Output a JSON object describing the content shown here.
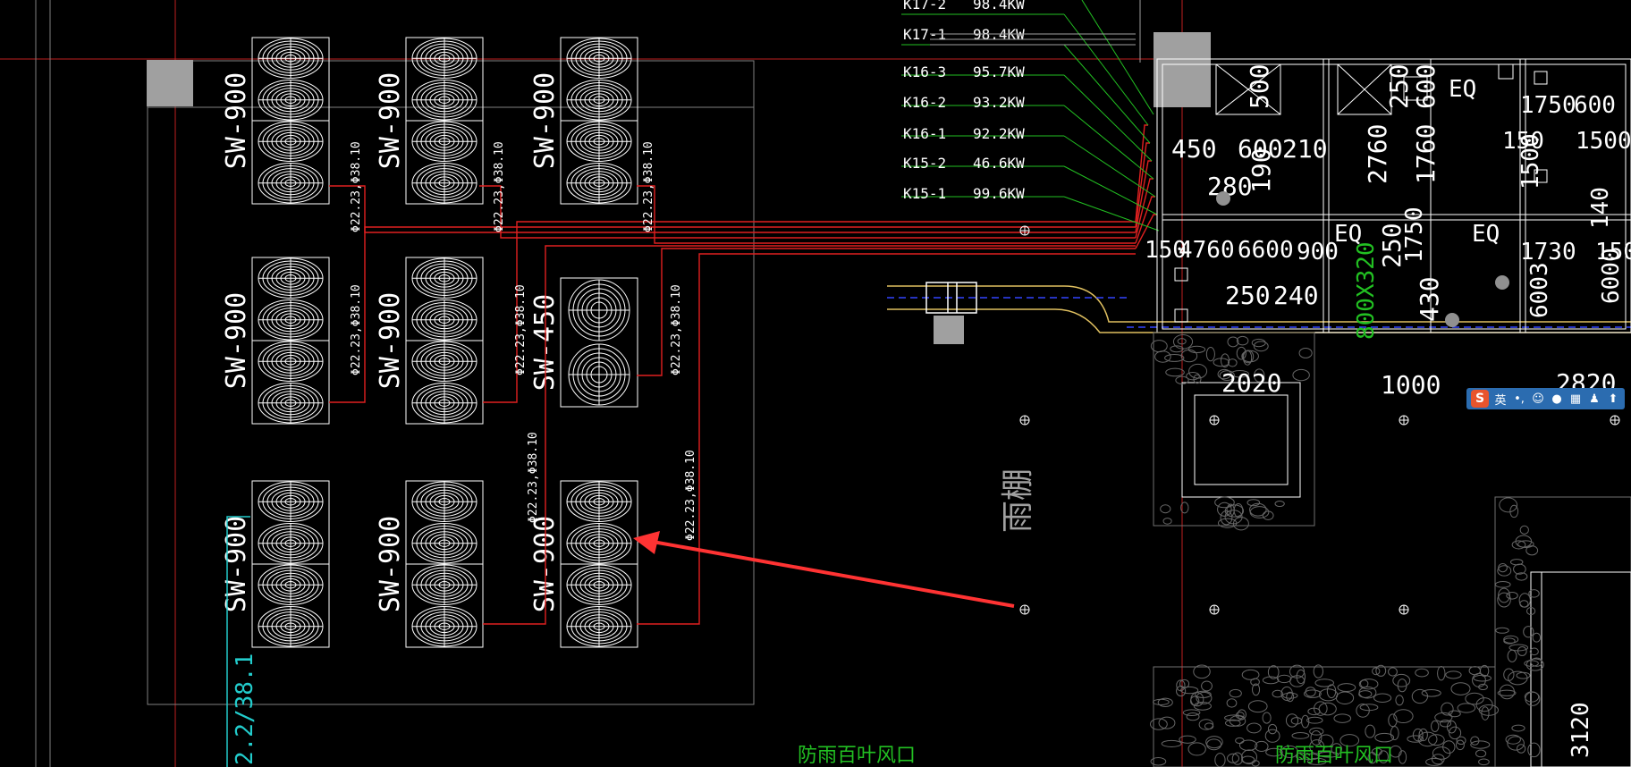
{
  "units": {
    "row1": [
      "SW-900",
      "SW-900",
      "SW-900"
    ],
    "row2": [
      "SW-900",
      "SW-900",
      "SW-450"
    ],
    "row3": [
      "SW-900",
      "SW-900",
      "SW-900"
    ]
  },
  "pipe_labels": [
    "Φ22.23,Φ38.10",
    "Φ22.23,Φ38.10",
    "Φ22.23,Φ38.10",
    "Φ22.23,Φ38.10",
    "Φ22.23,Φ38.10",
    "Φ22.23,Φ38.10",
    "Φ22.23,Φ38.10",
    "Φ22.23,Φ38.10"
  ],
  "circuits": [
    {
      "id": "K17-2",
      "power": "98.4KW"
    },
    {
      "id": "K17-1",
      "power": "98.4KW"
    },
    {
      "id": "K16-3",
      "power": "95.7KW"
    },
    {
      "id": "K16-2",
      "power": "93.2KW"
    },
    {
      "id": "K16-1",
      "power": "92.2KW"
    },
    {
      "id": "K15-2",
      "power": "46.6KW"
    },
    {
      "id": "K15-1",
      "power": "99.6KW"
    }
  ],
  "canopy_label": "雨棚",
  "louver_labels": [
    "防雨百叶风口",
    "防雨百叶风口"
  ],
  "side_pipe_label": "2.2/38.1",
  "dims": {
    "d450": "450",
    "d500": "500",
    "d600": "600",
    "d210": "210",
    "d280": "280",
    "d190": "190",
    "d2760": "2760",
    "d250": "250",
    "d1000": "1000",
    "d240": "240",
    "d150": "150",
    "d4760": "4760",
    "d6600": "6600",
    "d1750": "1750",
    "d1500": "1500",
    "d140": "140",
    "d2020": "2020",
    "d2820": "2820",
    "d430": "430",
    "d3120": "3120",
    "d1750b": "1750",
    "d600b": "600",
    "d1500b": "1500",
    "d250b": "250",
    "d150b": "150",
    "d1760": "1760",
    "d6000": "6000",
    "d6003": "6003",
    "d900": "900",
    "d1730": "1730"
  },
  "eq_labels": [
    "EQ",
    "EQ",
    "EQ"
  ],
  "green_dim": "800X320",
  "ime": {
    "logo": "S",
    "lang": "英",
    "punct": "•,",
    "emoji": "☺",
    "mic": "●",
    "kb": "▦",
    "user": "♟",
    "skin": "⬆"
  },
  "colors": {
    "bg": "#000000",
    "line": "#ffffff",
    "pipe": "#e02020",
    "green": "#22c022",
    "cyan": "#22cccc",
    "grey": "#a0a0a0",
    "yellow": "#e0c060",
    "arrow": "#ff3333"
  }
}
